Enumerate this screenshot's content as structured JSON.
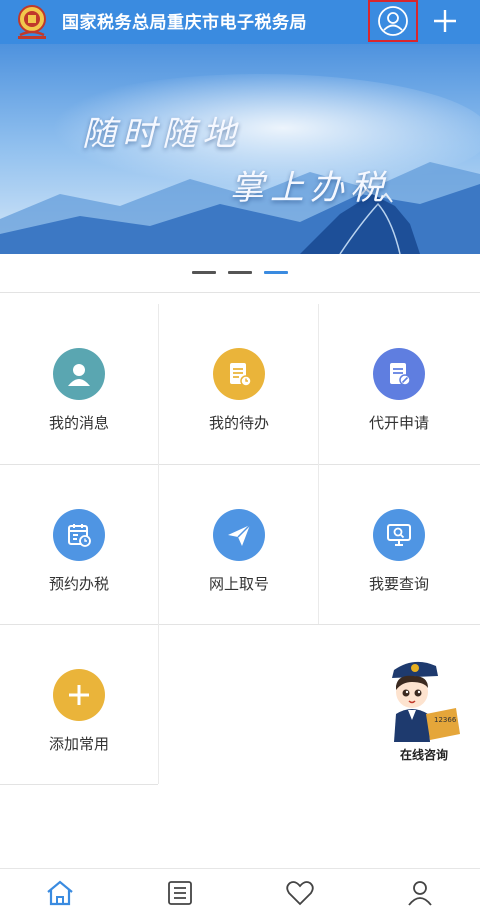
{
  "header": {
    "title": "国家税务总局重庆市电子税务局",
    "emblem_icon": "tax-emblem-icon",
    "user_icon": "user-icon",
    "add_icon": "plus-icon",
    "highlight_color": "#d9262c"
  },
  "banner": {
    "slogan_line1": "随时随地",
    "slogan_line2": "掌上办税",
    "page_count": 3,
    "active_page": 3
  },
  "grid": [
    {
      "label": "我的消息",
      "icon": "person-icon",
      "color": "#5aa6b1"
    },
    {
      "label": "我的待办",
      "icon": "document-clock-icon",
      "color": "#eab43a"
    },
    {
      "label": "代开申请",
      "icon": "document-edit-icon",
      "color": "#5f7ee0"
    },
    {
      "label": "预约办税",
      "icon": "calendar-clock-icon",
      "color": "#4f95e3"
    },
    {
      "label": "网上取号",
      "icon": "paper-plane-icon",
      "color": "#4f95e3"
    },
    {
      "label": "我要查询",
      "icon": "monitor-search-icon",
      "color": "#4f95e3"
    },
    {
      "label": "添加常用",
      "icon": "plus-icon",
      "color": "#eab43a"
    }
  ],
  "assistant": {
    "label": "在线咨询",
    "hotline": "12366"
  },
  "tabbar": [
    {
      "icon": "home-icon",
      "active": true
    },
    {
      "icon": "list-icon",
      "active": false
    },
    {
      "icon": "heart-icon",
      "active": false
    },
    {
      "icon": "user-icon",
      "active": false
    }
  ],
  "colors": {
    "accent": "#3a8be0"
  }
}
